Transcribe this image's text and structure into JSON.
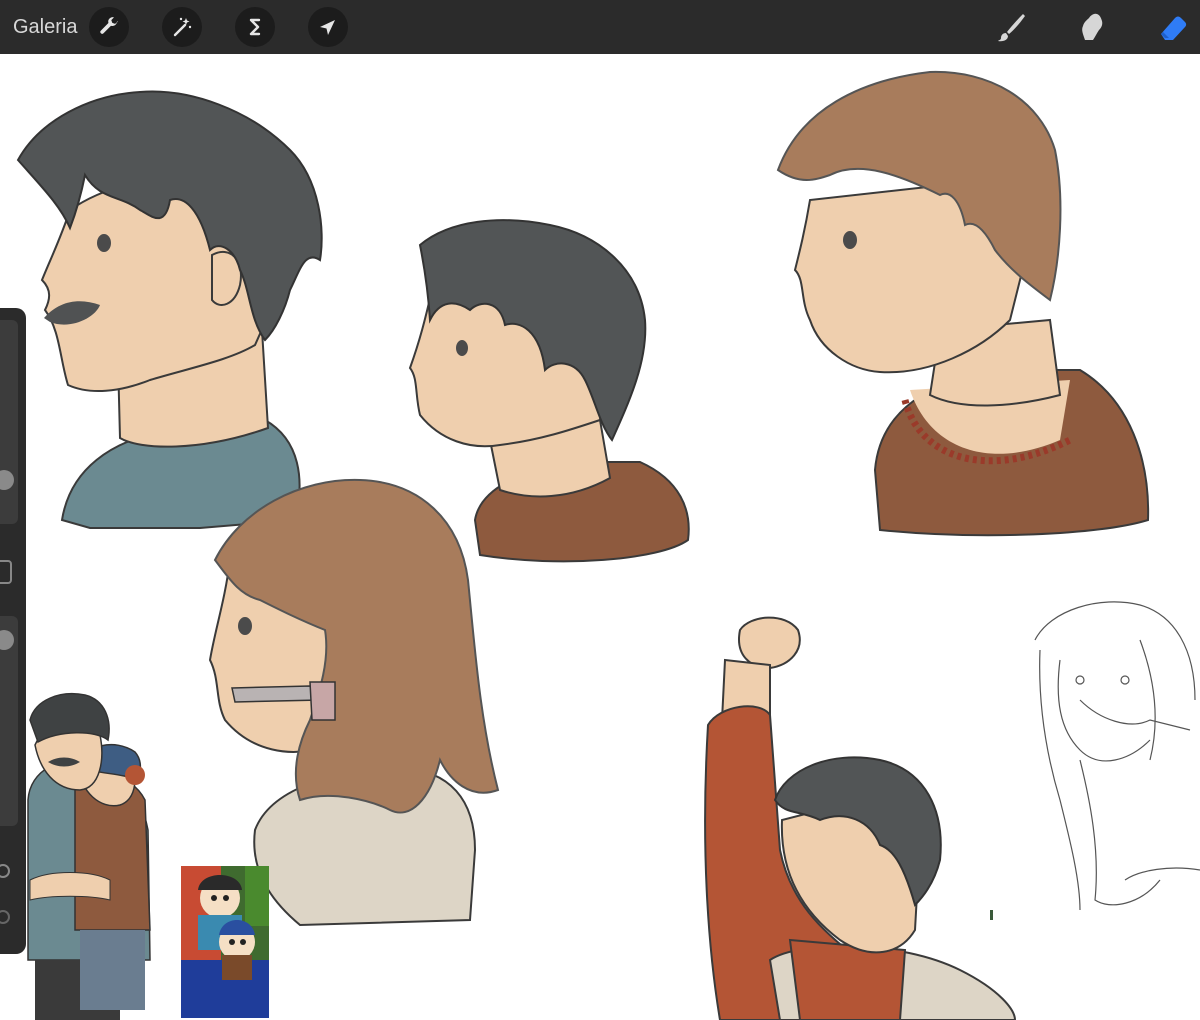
{
  "app": {
    "gallery_label": "Galeria"
  },
  "toolbar": {
    "left_tools": [
      {
        "icon": "wrench-icon"
      },
      {
        "icon": "magic-wand-icon"
      },
      {
        "icon": "selection-s-icon"
      },
      {
        "icon": "arrow-cursor-icon"
      }
    ],
    "right_tools": [
      {
        "icon": "brush-icon"
      },
      {
        "icon": "smudge-icon"
      },
      {
        "icon": "eraser-icon",
        "active": true
      }
    ],
    "active_color": "#2f7cf6"
  },
  "sidebar": {
    "brush_size_fraction": 0.1,
    "opacity_fraction": 0.95
  },
  "colors": {
    "hair_dark": "#525556",
    "hair_brown": "#a87c5c",
    "skin": "#efcfae",
    "shirt_blue": "#6b8a91",
    "shirt_brown": "#8e5a3e",
    "jacket_red": "#b45535",
    "hood_cream": "#ddd5c6"
  }
}
